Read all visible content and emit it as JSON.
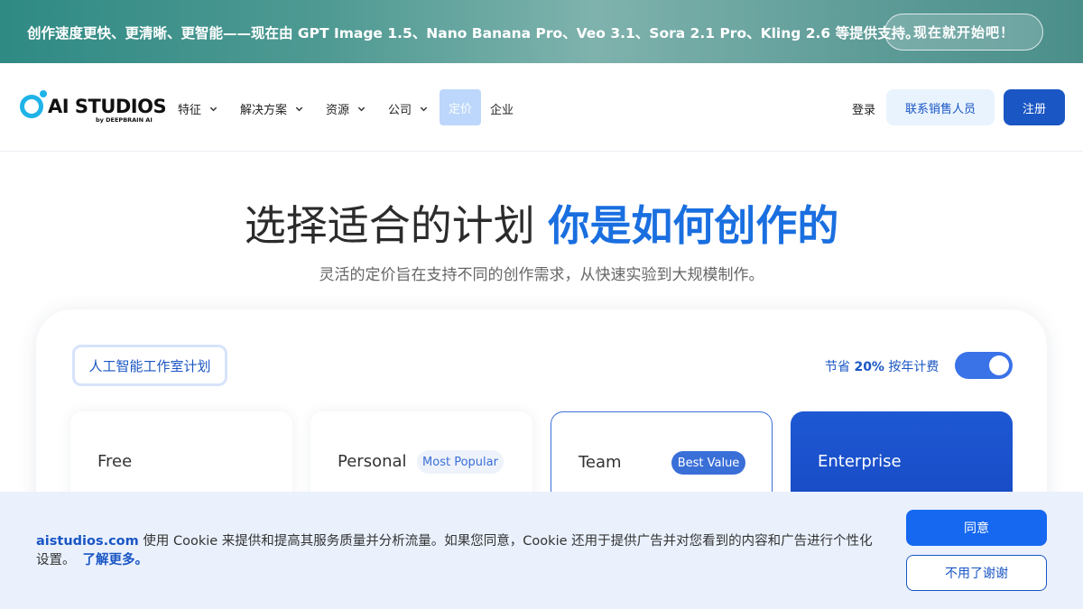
{
  "banner": {
    "text": "创作速度更快、更清晰、更智能——现在由 GPT Image 1.5、Nano Banana Pro、Veo 3.1、Sora 2.1 Pro、Kling 2.6 等提供支持。",
    "cta": "现在就开始吧！"
  },
  "logo": {
    "text": "AI STUDIOS",
    "sub": "by DEEPBRAIN AI"
  },
  "nav": {
    "items": [
      {
        "label": "特征",
        "icon": "chevron-down-icon"
      },
      {
        "label": "解决方案",
        "icon": "chevron-down-icon"
      },
      {
        "label": "资源",
        "icon": "chevron-down-icon"
      },
      {
        "label": "公司",
        "icon": "chevron-down-icon"
      }
    ],
    "pricing": "定价",
    "enterprise": "企业",
    "login": "登录",
    "contact_sales": "联系销售人员",
    "signup": "注册"
  },
  "hero": {
    "title_main": "选择适合的计划",
    "title_accent": "你是如何创作的",
    "subtitle": "灵活的定价旨在支持不同的创作需求，从快速实验到大规模制作。"
  },
  "pricing": {
    "plan_tab": "人工智能工作室计划",
    "save_prefix": "节省",
    "save_percent": "20%",
    "save_suffix": "按年计费",
    "annual_billing_on": true,
    "plans": [
      {
        "name": "Free"
      },
      {
        "name": "Personal",
        "badge": "Most Popular"
      },
      {
        "name": "Team",
        "badge": "Best Value"
      },
      {
        "name": "Enterprise"
      }
    ]
  },
  "cookie": {
    "domain": "aistudios.com",
    "text": " 使用 Cookie 来提供和提高其服务质量并分析流量。如果您同意，Cookie 还用于提供广告并对您看到的内容和广告进行个性化设置。",
    "learn_more": "了解更多。",
    "agree": "同意",
    "decline": "不用了谢谢"
  },
  "colors": {
    "brand_blue": "#1a56c4",
    "accent_blue": "#1a6fe0",
    "logo_cyan": "#1fb3e8",
    "banner_teal": "#4f9a93",
    "cookie_bg": "#eaf1fd"
  }
}
